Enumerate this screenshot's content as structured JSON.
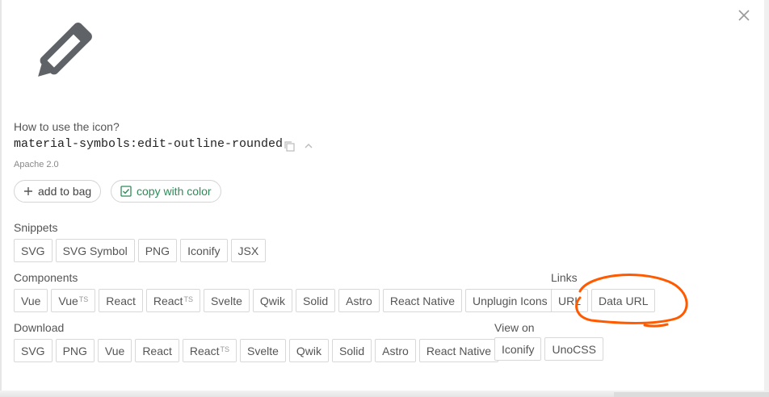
{
  "icon": {
    "name": "material-symbols:edit-outline-rounded",
    "license": "Apache 2.0"
  },
  "usage": {
    "title": "How to use the icon?"
  },
  "actions": {
    "add_to_bag": "add to bag",
    "copy_with_color": "copy with color"
  },
  "snippets": {
    "title": "Snippets",
    "items": [
      {
        "label": "SVG"
      },
      {
        "label": "SVG Symbol"
      },
      {
        "label": "PNG"
      },
      {
        "label": "Iconify"
      },
      {
        "label": "JSX"
      }
    ]
  },
  "components": {
    "title": "Components",
    "items": [
      {
        "label": "Vue",
        "sup": ""
      },
      {
        "label": "Vue",
        "sup": "TS"
      },
      {
        "label": "React",
        "sup": ""
      },
      {
        "label": "React",
        "sup": "TS"
      },
      {
        "label": "Svelte",
        "sup": ""
      },
      {
        "label": "Qwik",
        "sup": ""
      },
      {
        "label": "Solid",
        "sup": ""
      },
      {
        "label": "Astro",
        "sup": ""
      },
      {
        "label": "React Native",
        "sup": ""
      },
      {
        "label": "Unplugin Icons",
        "sup": ""
      }
    ]
  },
  "links": {
    "title": "Links",
    "items": [
      {
        "label": "URL"
      },
      {
        "label": "Data URL"
      }
    ]
  },
  "download": {
    "title": "Download",
    "items": [
      {
        "label": "SVG",
        "sup": ""
      },
      {
        "label": "PNG",
        "sup": ""
      },
      {
        "label": "Vue",
        "sup": ""
      },
      {
        "label": "React",
        "sup": ""
      },
      {
        "label": "React",
        "sup": "TS"
      },
      {
        "label": "Svelte",
        "sup": ""
      },
      {
        "label": "Qwik",
        "sup": ""
      },
      {
        "label": "Solid",
        "sup": ""
      },
      {
        "label": "Astro",
        "sup": ""
      },
      {
        "label": "React Native",
        "sup": ""
      }
    ]
  },
  "view_on": {
    "title": "View on",
    "items": [
      {
        "label": "Iconify"
      },
      {
        "label": "UnoCSS"
      }
    ]
  },
  "colors": {
    "annotation": "#ff5a00",
    "copy_green": "#2e8b57",
    "icon_gray": "#5f6368"
  }
}
